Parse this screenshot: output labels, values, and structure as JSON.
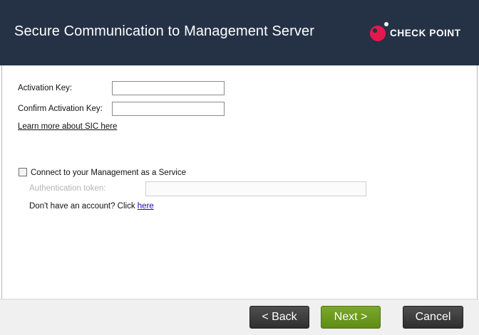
{
  "header": {
    "title": "Secure Communication to Management Server",
    "logo_text": "CHECK POINT"
  },
  "form": {
    "activation_key_label": "Activation Key:",
    "activation_key_value": "",
    "confirm_key_label": "Confirm Activation Key:",
    "confirm_key_value": "",
    "learn_more_link": "Learn more about SIC here",
    "connect_service_label": "Connect to your Management as a Service",
    "connect_service_checked": false,
    "auth_token_label": "Authentication token:",
    "auth_token_value": "",
    "no_account_text": "Don't have an account? Click ",
    "here_link": "here"
  },
  "footer": {
    "back_label": "< Back",
    "next_label": "Next >",
    "cancel_label": "Cancel"
  },
  "colors": {
    "header_bg": "#253246",
    "logo_accent": "#e5184e",
    "primary_button": "#6a9a1f",
    "secondary_button": "#3a3a3a"
  }
}
